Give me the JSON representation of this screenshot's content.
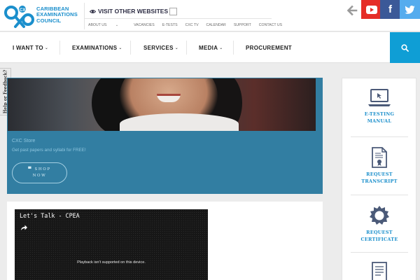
{
  "brand": {
    "logo_text": [
      "CARIBBEAN",
      "EXAMINATIONS",
      "COUNCIL"
    ],
    "logo_mark": "CXC",
    "logo_color": "#1b8fcc"
  },
  "header": {
    "visit_label": "VISIT OTHER WEBSITES",
    "visit_icon": "eye-icon",
    "sublinks": [
      {
        "label": "ABOUT US",
        "has_dropdown": true
      },
      {
        "label": "VACANCIES"
      },
      {
        "label": "E-TESTS"
      },
      {
        "label": "CXC TV"
      },
      {
        "label": "CALENDAR"
      },
      {
        "label": "SUPPORT"
      },
      {
        "label": "CONTACT US"
      }
    ],
    "social": [
      {
        "name": "youtube-icon",
        "color": "#e52d27"
      },
      {
        "name": "facebook-icon",
        "color": "#3b5998",
        "glyph": "f"
      },
      {
        "name": "twitter-icon",
        "color": "#55acee"
      }
    ]
  },
  "nav": {
    "items": [
      {
        "label": "I WANT TO",
        "dropdown": true
      },
      {
        "label": "EXAMINATIONS",
        "dropdown": true
      },
      {
        "label": "SERVICES",
        "dropdown": true
      },
      {
        "label": "MEDIA",
        "dropdown": true
      },
      {
        "label": "PROCUREMENT",
        "dropdown": false
      }
    ],
    "search_icon": "search-icon",
    "accent": "#0f9ed5"
  },
  "feedback_tab": {
    "label": "Help or Feedback?"
  },
  "promo": {
    "title": "CXC Store",
    "subtitle": "Get past papers and syllabi for FREE!",
    "button_line1": "SHOP",
    "button_line2": "NOW",
    "button_icon": "cart-icon",
    "background": "#327ea2"
  },
  "video": {
    "title": "Let's Talk - CPEA",
    "share_icon": "share-icon",
    "message": "Playback isn't supported on this device."
  },
  "sidebar": {
    "items": [
      {
        "label_lines": [
          "E-TESTING",
          "MANUAL"
        ],
        "icon": "laptop-icon"
      },
      {
        "label_lines": [
          "REQUEST",
          "TRANSCRIPT"
        ],
        "icon": "certificate-document-icon"
      },
      {
        "label_lines": [
          "REQUEST",
          "CERTIFICATE"
        ],
        "icon": "seal-icon"
      },
      {
        "label_lines": [],
        "icon": "document-icon"
      }
    ]
  }
}
